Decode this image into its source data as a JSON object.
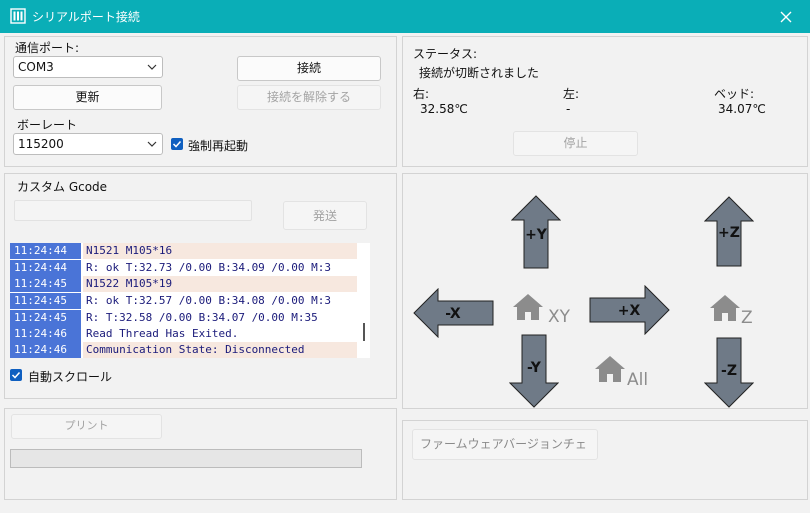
{
  "window": {
    "title": "シリアルポート接続",
    "app_icon": "serial-app-icon",
    "close_icon": "close-icon"
  },
  "connection": {
    "port_label": "通信ポート:",
    "port_value": "COM3",
    "refresh_label": "更新",
    "baud_label": "ボーレート",
    "baud_value": "115200",
    "force_reset_label": "強制再起動",
    "force_reset_checked": true,
    "connect_label": "接続",
    "disconnect_label": "接続を解除する"
  },
  "status": {
    "status_label": "ステータス:",
    "status_value": "接続が切断されました",
    "right_label": "右:",
    "right_value": "32.58℃",
    "left_label": "左:",
    "left_value": "-",
    "bed_label": "ベッド:",
    "bed_value": "34.07℃",
    "stop_label": "停止"
  },
  "gcode": {
    "title": "カスタム Gcode",
    "input_value": "",
    "send_label": "発送",
    "autoscroll_label": "自動スクロール",
    "autoscroll_checked": true,
    "log": [
      {
        "time": "11:24:44",
        "text": "N1521 M105*16",
        "kind": "send"
      },
      {
        "time": "11:24:44",
        "text": "R: ok T:32.73 /0.00 B:34.09 /0.00 M:3",
        "kind": "recv"
      },
      {
        "time": "11:24:45",
        "text": "N1522 M105*19",
        "kind": "send"
      },
      {
        "time": "11:24:45",
        "text": "R: ok T:32.57 /0.00 B:34.08 /0.00 M:3",
        "kind": "recv"
      },
      {
        "time": "11:24:45",
        "text": "R:  T:32.58 /0.00 B:34.07 /0.00 M:35",
        "kind": "recv"
      },
      {
        "time": "11:24:46",
        "text": "Read Thread Has Exited.",
        "kind": "info"
      },
      {
        "time": "11:24:46",
        "text": "Communication State: Disconnected",
        "kind": "send"
      }
    ]
  },
  "print": {
    "print_label": "プリント",
    "progress": 0
  },
  "firmware": {
    "version_label": "ファームウェアバージョンチェ"
  },
  "jog": {
    "plus_y": "+Y",
    "minus_y": "-Y",
    "minus_x": "-X",
    "plus_x": "+X",
    "plus_z": "+Z",
    "minus_z": "-Z",
    "home_xy": "XY",
    "home_z": "Z",
    "home_all": "All",
    "home_icon": "home-icon",
    "arrow_color": "#6f7a87",
    "home_color": "#8c8c8c"
  },
  "colors": {
    "titlebar": "#0aaeb7",
    "timestamp": "#4a74d7",
    "send_row": "#f7e8df",
    "checkbox": "#0f5fc0"
  }
}
